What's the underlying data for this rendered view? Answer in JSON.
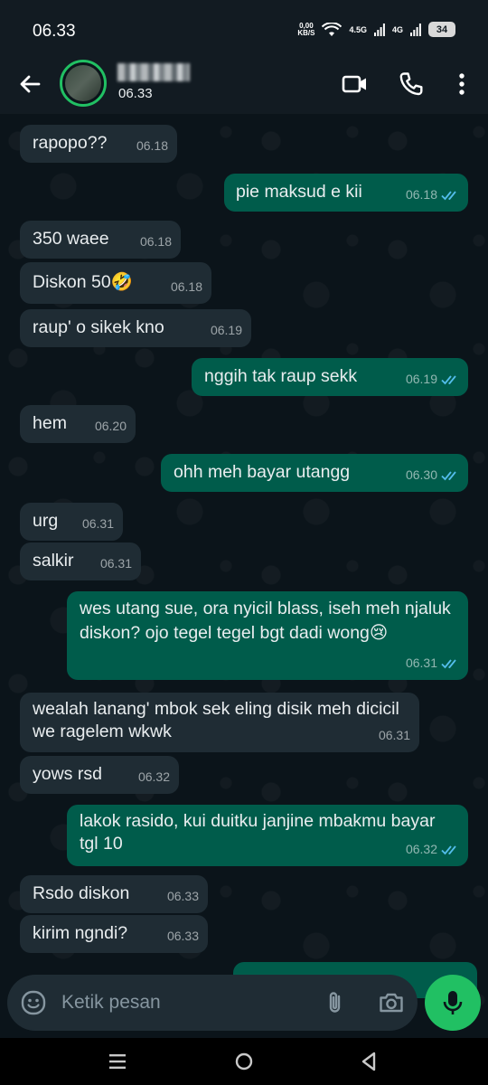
{
  "status_bar": {
    "time": "06.33",
    "net_speed_value": "0,00",
    "net_speed_unit": "KB/S",
    "sig1_label": "4.5G",
    "sig2_label": "4G",
    "battery": "34"
  },
  "header": {
    "status": "06.33"
  },
  "messages": [
    {
      "dir": "in",
      "text": "rapopo??",
      "time": "06.18"
    },
    {
      "dir": "out",
      "text": "pie maksud e kii",
      "time": "06.18"
    },
    {
      "dir": "in",
      "text": "350 waee",
      "time": "06.18"
    },
    {
      "dir": "in",
      "text": "Diskon 50🤣",
      "time": "06.18"
    },
    {
      "dir": "in",
      "text": "raup' o sikek kno",
      "time": "06.19"
    },
    {
      "dir": "out",
      "text": "nggih tak raup sekk",
      "time": "06.19"
    },
    {
      "dir": "in",
      "text": "hem",
      "time": "06.20"
    },
    {
      "dir": "out",
      "text": "ohh meh bayar utangg",
      "time": "06.30"
    },
    {
      "dir": "in",
      "text": "urg",
      "time": "06.31"
    },
    {
      "dir": "in",
      "text": "salkir",
      "time": "06.31"
    },
    {
      "dir": "out",
      "text": "wes utang sue, ora nyicil blass, iseh meh njaluk diskon? ojo tegel tegel bgt dadi wong😢",
      "time": "06.31"
    },
    {
      "dir": "in",
      "text": "wealah lanang' mbok sek eling disik meh dicicil we ragelem wkwk",
      "time": "06.31"
    },
    {
      "dir": "in",
      "text": "yows rsd",
      "time": "06.32"
    },
    {
      "dir": "out",
      "text": "lakok rasido, kui duitku janjine mbakmu bayar tgl 10",
      "time": "06.32"
    },
    {
      "dir": "in",
      "text": "Rsdo diskon",
      "time": "06.33"
    },
    {
      "dir": "in",
      "text": "kirim ngndi?",
      "time": "06.33"
    }
  ],
  "input": {
    "placeholder": "Ketik pesan"
  },
  "colors": {
    "incoming_bubble": "#1f2c34",
    "outgoing_bubble": "#005c4b",
    "accent_green": "#21c063",
    "read_ticks": "#53bdeb",
    "background": "#0b141a"
  },
  "icons": [
    "back-arrow-icon",
    "video-call-icon",
    "voice-call-icon",
    "more-options-icon",
    "emoji-icon",
    "attach-icon",
    "camera-icon",
    "mic-icon",
    "nav-menu-icon",
    "nav-home-icon",
    "nav-back-icon"
  ]
}
